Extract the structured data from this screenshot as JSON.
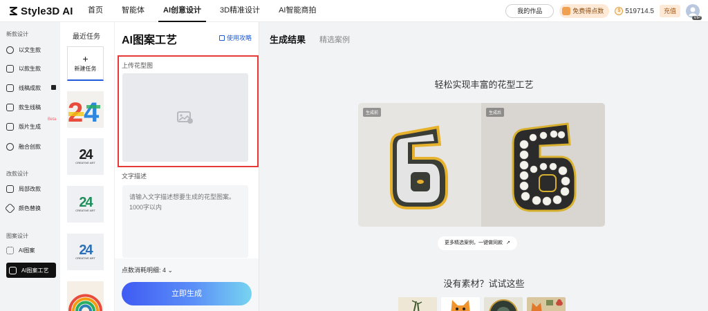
{
  "header": {
    "logo_text": "Style3D AI",
    "nav": [
      {
        "label": "首页"
      },
      {
        "label": "智能体"
      },
      {
        "label": "AI创意设计"
      },
      {
        "label": "3D精准设计"
      },
      {
        "label": "AI智能商拍"
      }
    ],
    "active_nav": "AI创意设计",
    "my_works": "我的作品",
    "free_points": "免费得点数",
    "points_value": "519714.5",
    "recharge": "充值",
    "vip": "VIP"
  },
  "sidebar": {
    "sections": [
      {
        "title": "新款设计",
        "items": [
          {
            "label": "以文生款"
          },
          {
            "label": "以款生款"
          },
          {
            "label": "线稿成款"
          },
          {
            "label": "款生线稿"
          },
          {
            "label": "版片生成",
            "badge": "Beta"
          },
          {
            "label": "融合创款"
          }
        ]
      },
      {
        "title": "改款设计",
        "items": [
          {
            "label": "局部改款"
          },
          {
            "label": "颜色替换"
          }
        ]
      },
      {
        "title": "图案设计",
        "items": [
          {
            "label": "AI图案"
          },
          {
            "label": "AI图案工艺",
            "active": true
          }
        ]
      }
    ]
  },
  "tasks": {
    "title": "最近任务",
    "new_task": "新建任务",
    "thumbnails": [
      {
        "text": "24",
        "sub": ""
      },
      {
        "text": "24",
        "sub": "CREATIVE ART"
      },
      {
        "text": "24",
        "sub": "CREATIVE ART"
      },
      {
        "text": "24",
        "sub": "CREATIVE ART"
      },
      {
        "text": "",
        "sub": ""
      }
    ]
  },
  "form": {
    "title": "AI图案工艺",
    "guide": "使用攻略",
    "upload_label": "上传花型图",
    "desc_label": "文字描述",
    "desc_placeholder": "请输入文字描述想要生成的花型图案。\n1000字以内",
    "cost": "点数消耗明细: 4",
    "generate": "立即生成"
  },
  "result": {
    "tab_result": "生成结果",
    "tab_cases": "精选案例",
    "hero_title": "轻松实现丰富的花型工艺",
    "before_badge": "生成前",
    "after_badge": "生成后",
    "more_cases": "更多精选案例，一键做同款",
    "no_material": "没有素材？试试这些"
  },
  "colors": {
    "accent_blue": "#1f5bd8",
    "highlight_red": "#e53935",
    "gradient_start": "#3f5bf3",
    "gradient_end": "#77d4f0"
  }
}
